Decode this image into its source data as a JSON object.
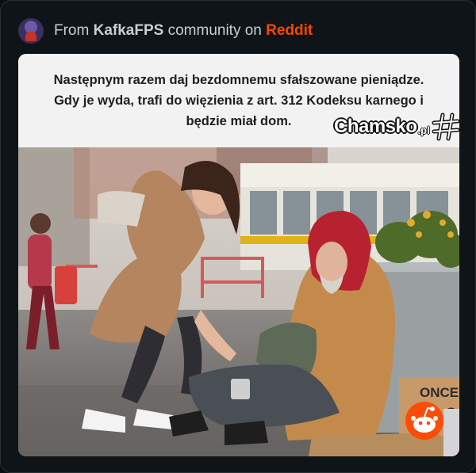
{
  "header": {
    "prefix": "From",
    "community": "KafkaFPS",
    "middle": "community on",
    "platform": "Reddit",
    "colors": {
      "text": "#c9ced4",
      "platform": "#ff4500",
      "background": "#0f1418"
    }
  },
  "post": {
    "caption_lines": [
      "Następnym razem daj bezdomnemu sfałszowane pieniądze.",
      "Gdy je wyda, trafi do więzienia z art. 312 Kodeksu karnego i",
      "będzie miał dom."
    ],
    "watermark": {
      "name": "Chamsko",
      "suffix": ".pl",
      "icon": "hash-icon"
    },
    "photo": {
      "sign_text": "ONCE",
      "sign_text_2": "S",
      "icons": [
        "reddit-snoo-icon",
        "avatar-icon"
      ]
    }
  }
}
